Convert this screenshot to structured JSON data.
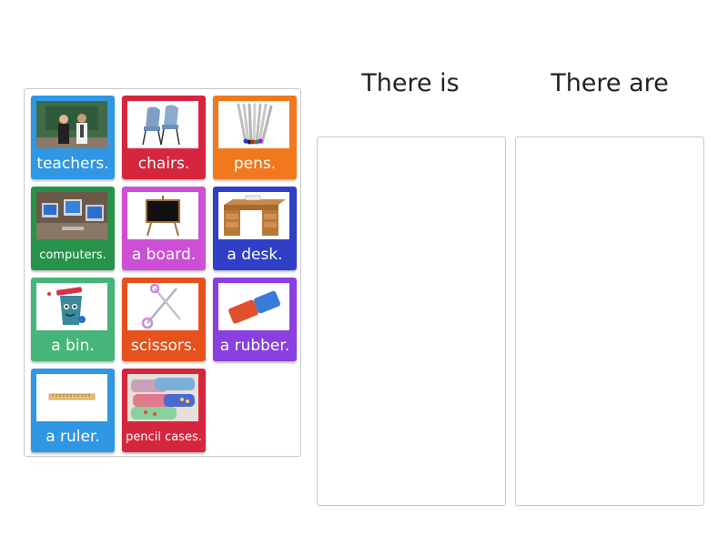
{
  "columns": [
    {
      "title": "There is"
    },
    {
      "title": "There are"
    }
  ],
  "cards": [
    {
      "label": "teachers.",
      "color": "#2f97e4",
      "icon": "teachers-photo"
    },
    {
      "label": "chairs.",
      "color": "#d6263e",
      "icon": "chairs-photo"
    },
    {
      "label": "pens.",
      "color": "#f0791e",
      "icon": "pens-photo"
    },
    {
      "label": "computers.",
      "color": "#27934a",
      "icon": "computers-photo"
    },
    {
      "label": "a board.",
      "color": "#cc4fd6",
      "icon": "board-photo"
    },
    {
      "label": "a desk.",
      "color": "#2f3fc8",
      "icon": "desk-photo"
    },
    {
      "label": "a bin.",
      "color": "#46b57a",
      "icon": "bin-photo"
    },
    {
      "label": "scissors.",
      "color": "#e5521c",
      "icon": "scissors-photo"
    },
    {
      "label": "a rubber.",
      "color": "#8a3fe0",
      "icon": "rubber-photo"
    },
    {
      "label": "a ruler.",
      "color": "#2f97e4",
      "icon": "ruler-photo"
    },
    {
      "label": "pencil cases.",
      "color": "#d6263e",
      "icon": "pencil-cases-photo"
    }
  ]
}
